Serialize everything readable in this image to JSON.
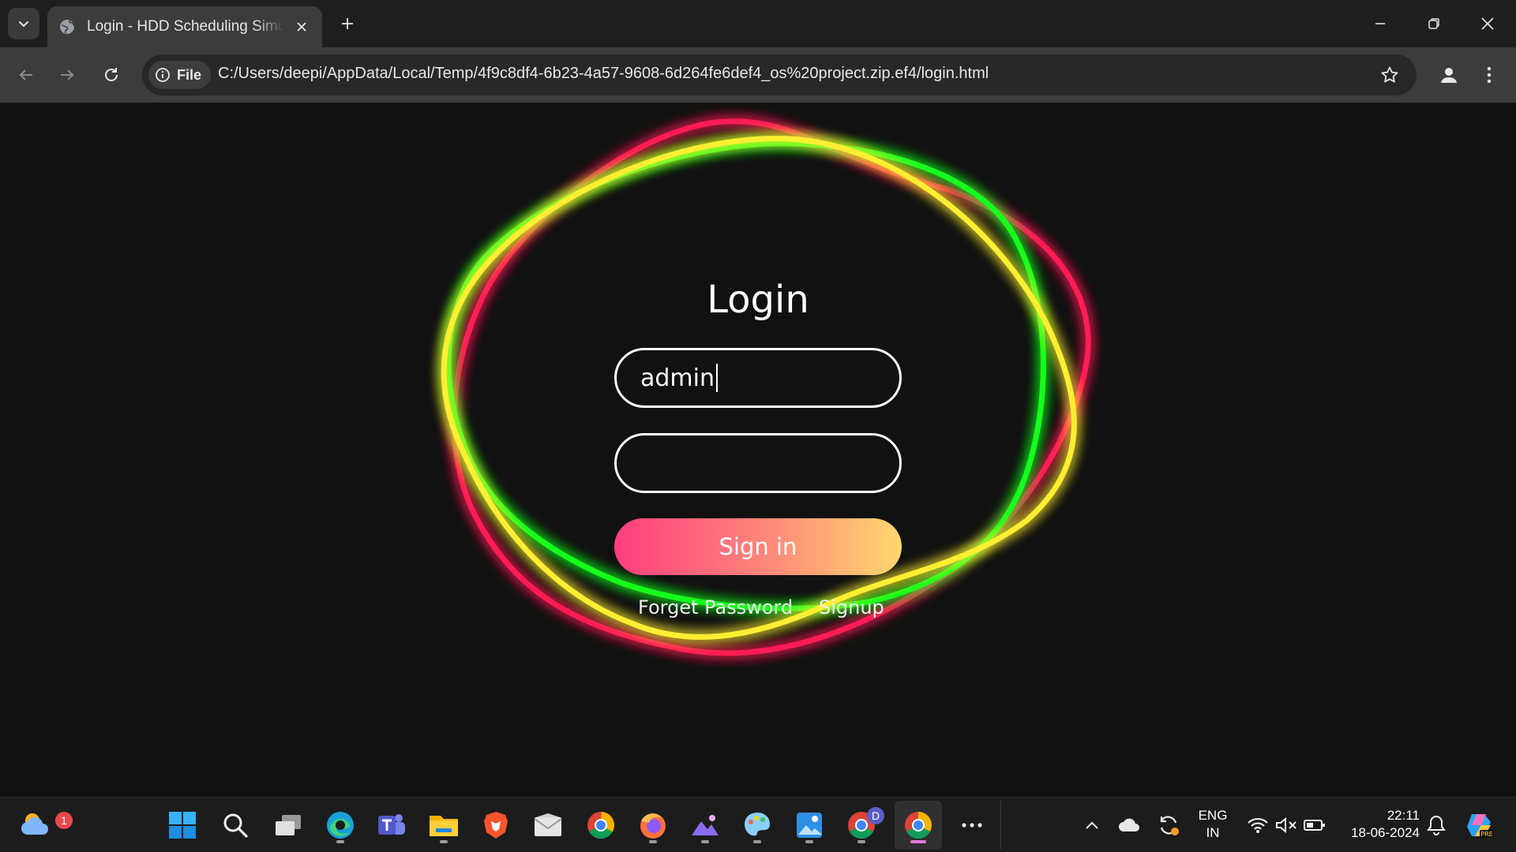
{
  "browser": {
    "tab_title": "Login - HDD Scheduling Simula",
    "site_chip_label": "File",
    "url": "C:/Users/deepi/AppData/Local/Temp/4f9c8df4-6b23-4a57-9608-6d264fe6def4_os%20project.zip.ef4/login.html"
  },
  "login": {
    "title": "Login",
    "username_value": "admin",
    "password_value": "",
    "signin_label": "Sign in",
    "forgot_label": "Forget Password",
    "signup_label": "Signup"
  },
  "colors": {
    "ring_red": "#ff1a55",
    "ring_green": "#19ff1f",
    "ring_yellow": "#ffee33",
    "background": "#111111",
    "button_gradient": [
      "#ff3d7f",
      "#ffd86e"
    ]
  },
  "taskbar": {
    "weather_badge": "1",
    "chrome_profile_badge": "D",
    "lang_line1": "ENG",
    "lang_line2": "IN",
    "time": "22:11",
    "date": "18-06-2024",
    "icons": [
      "weather-icon",
      "windows-start-icon",
      "search-icon",
      "task-view-icon",
      "edge-icon",
      "teams-icon",
      "file-explorer-icon",
      "brave-icon",
      "mail-icon",
      "chrome-icon",
      "firefox-icon",
      "photos-icon",
      "paint-icon",
      "image-viewer-icon",
      "chrome-profile-icon",
      "chrome-active-icon",
      "more-apps-icon"
    ]
  }
}
